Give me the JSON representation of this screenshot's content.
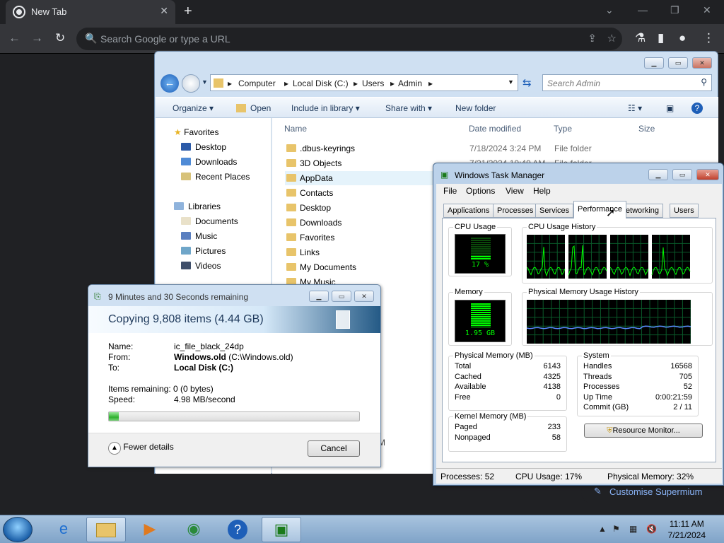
{
  "browser": {
    "tab_title": "New Tab",
    "omnibox_placeholder": "Search Google or type a URL",
    "customise_label": "Customise Supermium"
  },
  "explorer": {
    "breadcrumb": [
      "Computer",
      "Local Disk (C:)",
      "Users",
      "Admin"
    ],
    "search_placeholder": "Search Admin",
    "commands": [
      "Organize",
      "Open",
      "Include in library",
      "Share with",
      "New folder"
    ],
    "nav": {
      "favorites_label": "Favorites",
      "favorites": [
        "Desktop",
        "Downloads",
        "Recent Places"
      ],
      "libraries_label": "Libraries",
      "libraries": [
        "Documents",
        "Music",
        "Pictures",
        "Videos"
      ]
    },
    "columns": [
      "Name",
      "Date modified",
      "Type",
      "Size"
    ],
    "rows": [
      {
        "name": ".dbus-keyrings",
        "date": "7/18/2024 3:24 PM",
        "type": "File folder"
      },
      {
        "name": "3D Objects",
        "date": "7/21/2024 10:49 AM",
        "type": "File folder"
      },
      {
        "name": "AppData",
        "date": "",
        "type": ""
      },
      {
        "name": "Contacts",
        "date": "",
        "type": ""
      },
      {
        "name": "Desktop",
        "date": "",
        "type": ""
      },
      {
        "name": "Downloads",
        "date": "",
        "type": ""
      },
      {
        "name": "Favorites",
        "date": "",
        "type": ""
      },
      {
        "name": "Links",
        "date": "",
        "type": ""
      },
      {
        "name": "My Documents",
        "date": "",
        "type": ""
      },
      {
        "name": "My Music",
        "date": "",
        "type": ""
      }
    ],
    "partial_text": "M"
  },
  "copy_dialog": {
    "title": "9 Minutes and 30 Seconds remaining",
    "heading": "Copying 9,808 items (4.44 GB)",
    "name_label": "Name:",
    "name_value": "ic_file_black_24dp",
    "from_label": "From:",
    "from_bold": "Windows.old",
    "from_path": " (C:\\Windows.old)",
    "to_label": "To:",
    "to_value": "Local Disk (C:)",
    "items_remaining": "Items remaining:  0 (0 bytes)",
    "speed_label": "Speed:",
    "speed_value": "4.98 MB/second",
    "progress": 0.04,
    "fewer_details": "Fewer details",
    "cancel": "Cancel"
  },
  "task_manager": {
    "title": "Windows Task Manager",
    "menu": [
      "File",
      "Options",
      "View",
      "Help"
    ],
    "tabs": [
      "Applications",
      "Processes",
      "Services",
      "Performance",
      "Networking",
      "Users"
    ],
    "active_tab": "Performance",
    "cpu_usage_label": "CPU Usage",
    "cpu_value": "17 %",
    "cpu_history_label": "CPU Usage History",
    "memory_label": "Memory",
    "memory_value": "1.95 GB",
    "phys_history_label": "Physical Memory Usage History",
    "physical_memory": {
      "label": "Physical Memory (MB)",
      "rows": [
        [
          "Total",
          "6143"
        ],
        [
          "Cached",
          "4325"
        ],
        [
          "Available",
          "4138"
        ],
        [
          "Free",
          "0"
        ]
      ]
    },
    "kernel_memory": {
      "label": "Kernel Memory (MB)",
      "rows": [
        [
          "Paged",
          "233"
        ],
        [
          "Nonpaged",
          "58"
        ]
      ]
    },
    "system": {
      "label": "System",
      "rows": [
        [
          "Handles",
          "16568"
        ],
        [
          "Threads",
          "705"
        ],
        [
          "Processes",
          "52"
        ],
        [
          "Up Time",
          "0:00:21:59"
        ],
        [
          "Commit (GB)",
          "2 / 11"
        ]
      ]
    },
    "resource_monitor": "Resource Monitor...",
    "status": {
      "processes": "Processes: 52",
      "cpu": "CPU Usage: 17%",
      "memory": "Physical Memory: 32%"
    }
  },
  "taskbar": {
    "time": "11:11 AM",
    "date": "7/21/2024"
  },
  "colors": {
    "chrome_dark": "#202124",
    "aero_blue": "#cfe0f2",
    "meter_green": "#00ff00"
  }
}
